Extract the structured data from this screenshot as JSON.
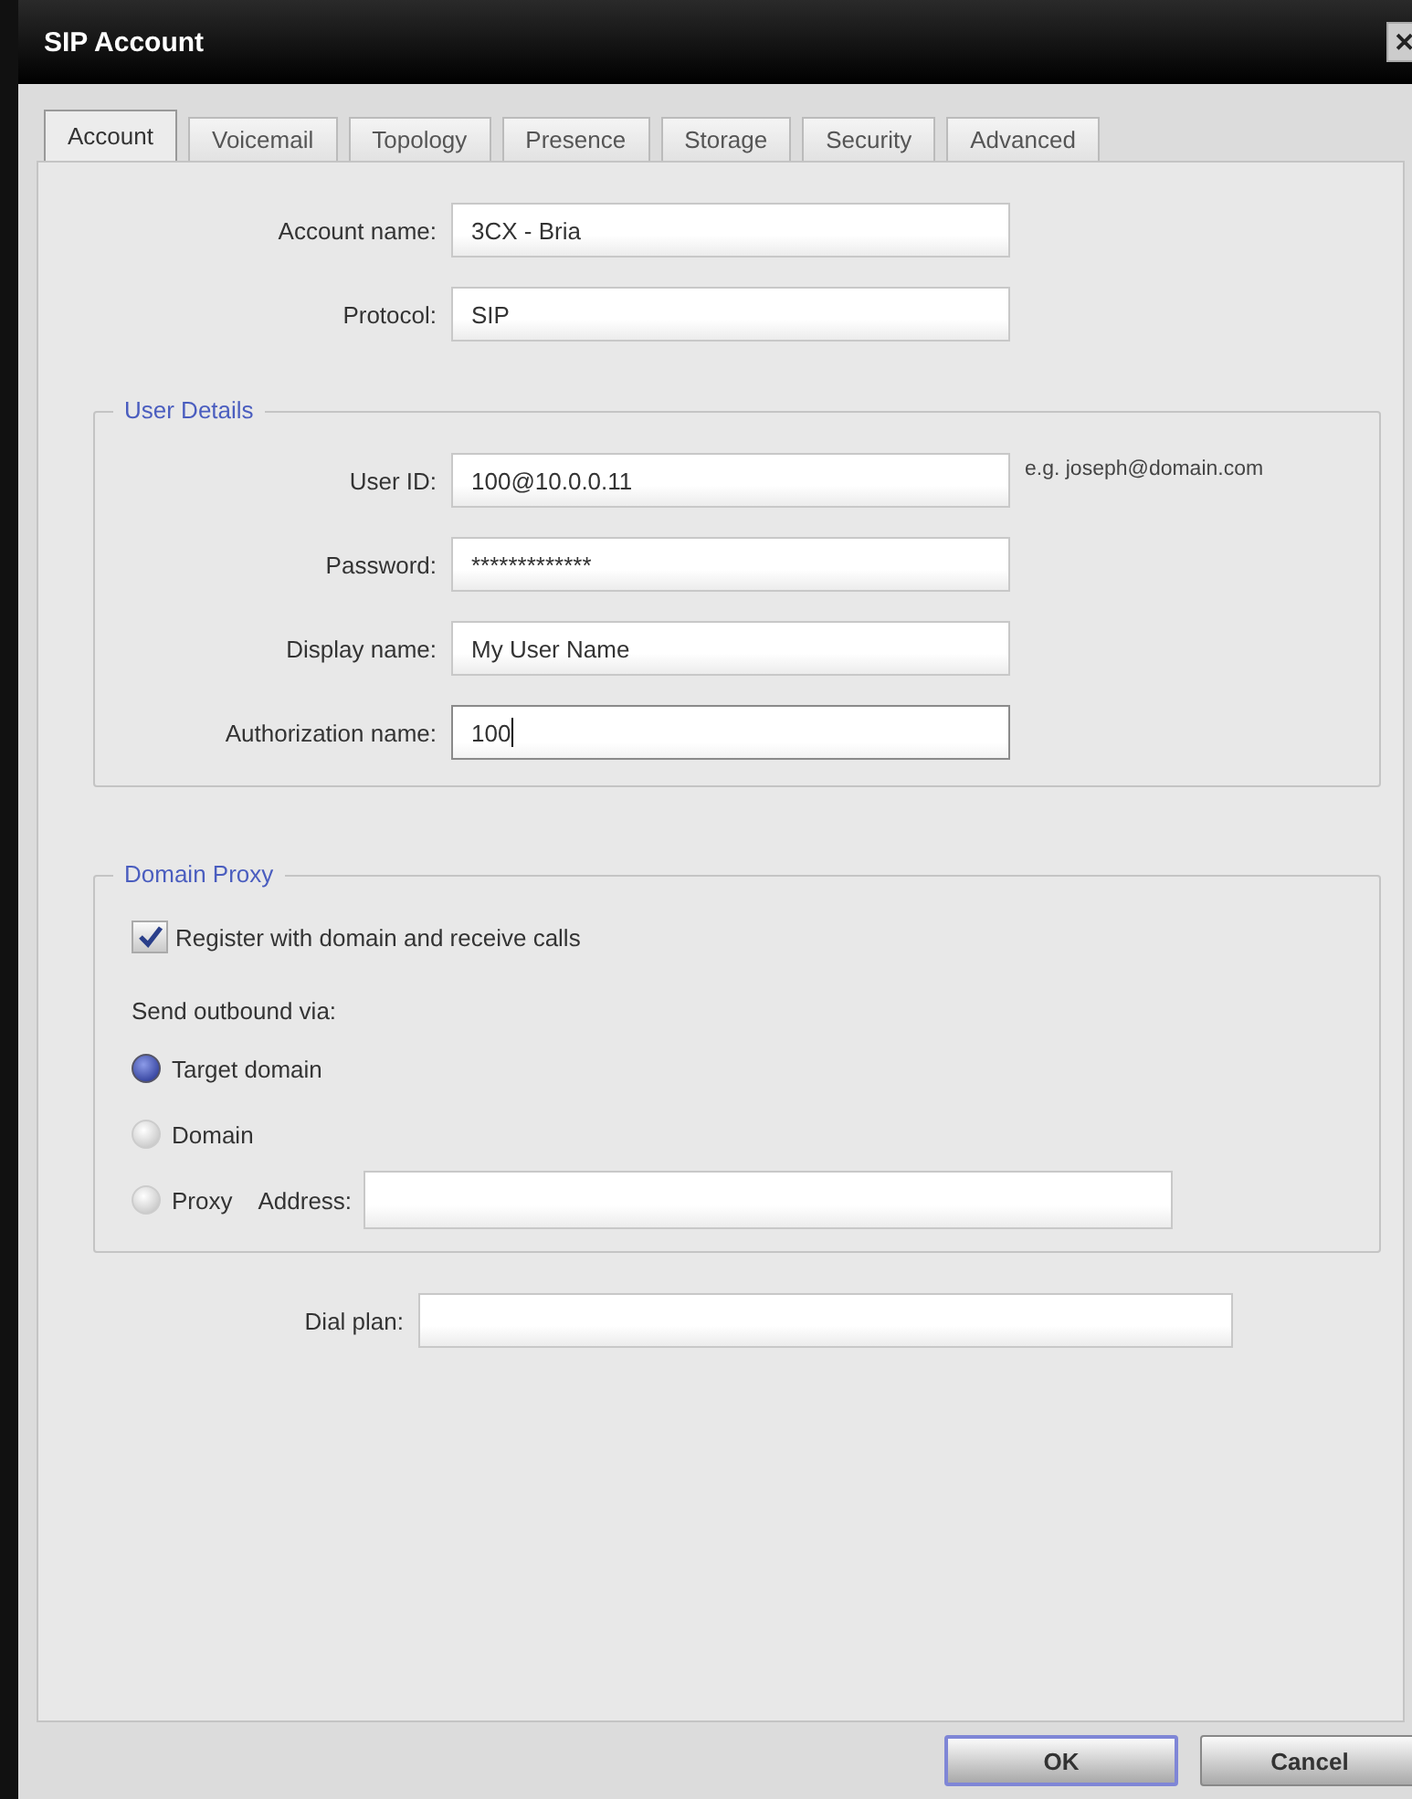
{
  "window": {
    "title": "SIP Account",
    "close": "✕"
  },
  "tabs": [
    {
      "label": "Account",
      "selected": true
    },
    {
      "label": "Voicemail",
      "selected": false
    },
    {
      "label": "Topology",
      "selected": false
    },
    {
      "label": "Presence",
      "selected": false
    },
    {
      "label": "Storage",
      "selected": false
    },
    {
      "label": "Security",
      "selected": false
    },
    {
      "label": "Advanced",
      "selected": false
    }
  ],
  "account_fields": [
    {
      "label": "Account name:",
      "value": "3CX - Bria",
      "focused": false
    },
    {
      "label": "Protocol:",
      "value": "SIP",
      "focused": false
    }
  ],
  "user_details": {
    "title": "User Details",
    "fields": [
      {
        "label": "User ID:",
        "value": "100@10.0.0.11",
        "hint": "e.g. joseph@domain.com",
        "focused": false
      },
      {
        "label": "Password:",
        "value": "*************",
        "focused": false
      },
      {
        "label": "Display name:",
        "value": "My User Name",
        "focused": false
      },
      {
        "label": "Authorization name:",
        "value": "100",
        "focused": true
      }
    ]
  },
  "domain_proxy": {
    "title": "Domain Proxy",
    "register": {
      "label": "Register with domain and receive calls",
      "checked": true
    },
    "outbound_label": "Send outbound via:",
    "options": [
      {
        "label": "Target domain",
        "selected": true
      },
      {
        "label": "Domain",
        "selected": false
      },
      {
        "label": "Proxy",
        "selected": false,
        "address_label": "Address:"
      }
    ]
  },
  "dial_plan": {
    "label": "Dial plan:"
  },
  "buttons": [
    {
      "label": "OK",
      "default": true
    },
    {
      "label": "Cancel",
      "default": false
    }
  ]
}
